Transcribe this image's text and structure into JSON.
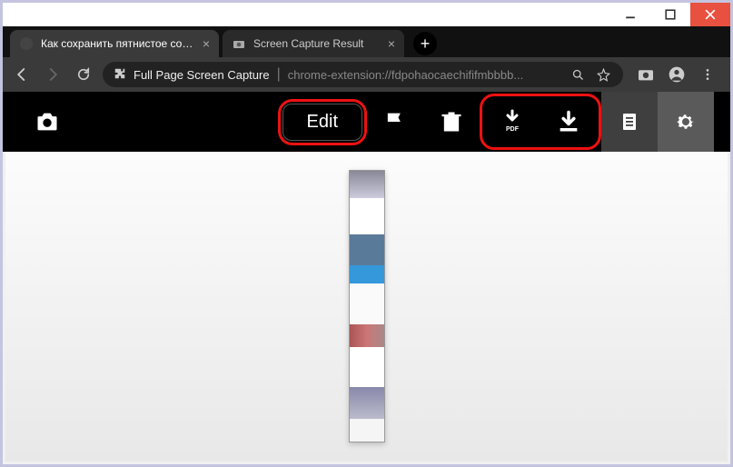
{
  "window": {
    "tabs": [
      {
        "title": "Как сохранить пятнистое сокро",
        "active": true
      },
      {
        "title": "Screen Capture Result",
        "active": false
      }
    ]
  },
  "addressbar": {
    "title": "Full Page Screen Capture",
    "url": "chrome-extension://fdpohaocaechififmbbbb..."
  },
  "toolbar": {
    "edit_label": "Edit",
    "pdf_label": "PDF"
  }
}
